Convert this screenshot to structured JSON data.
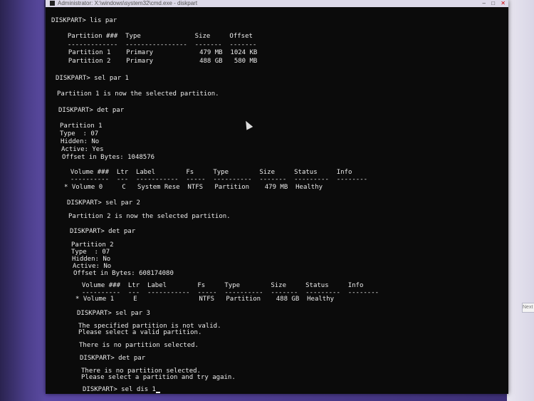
{
  "window": {
    "title": "Administrator: X:\\windows\\system32\\cmd.exe - diskpart"
  },
  "side_panel": {
    "button_label": "Next"
  },
  "console_lines": [
    "DISKPART> lis par",
    "  Partition ###  Type              Size     Offset",
    "  -------------  ----------------  -------  -------",
    "  Partition 1    Primary            479 MB  1024 KB",
    "  Partition 2    Primary            488 GB   580 MB",
    "DISKPART> sel par 1",
    "Partition 1 is now the selected partition.",
    "DISKPART> det par",
    "Partition 1",
    "Type  : 07",
    "Hidden: No",
    "Active: Yes",
    "Offset in Bytes: 1048576",
    "  Volume ###  Ltr  Label        Fs     Type        Size     Status     Info",
    "  ----------  ---  -----------  -----  ----------  -------  ---------  --------",
    "* Volume 0     C   System Rese  NTFS   Partition    479 MB  Healthy",
    "DISKPART> sel par 2",
    "Partition 2 is now the selected partition.",
    "DISKPART> det par",
    "Partition 2",
    "Type  : 07",
    "Hidden: No",
    "Active: No",
    "Offset in Bytes: 608174080",
    "  Volume ###  Ltr  Label        Fs     Type        Size     Status     Info",
    "  ----------  ---  -----------  -----  ----------  -------  ---------  --------",
    "* Volume 1     E                NTFS   Partition    488 GB  Healthy",
    "DISKPART> sel par 3",
    "The specified partition is not valid.",
    "Please select a valid partition.",
    "There is no partition selected.",
    "DISKPART> det par",
    "There is no partition selected.",
    "Please select a partition and try again.",
    "DISKPART> sel dis 1"
  ]
}
